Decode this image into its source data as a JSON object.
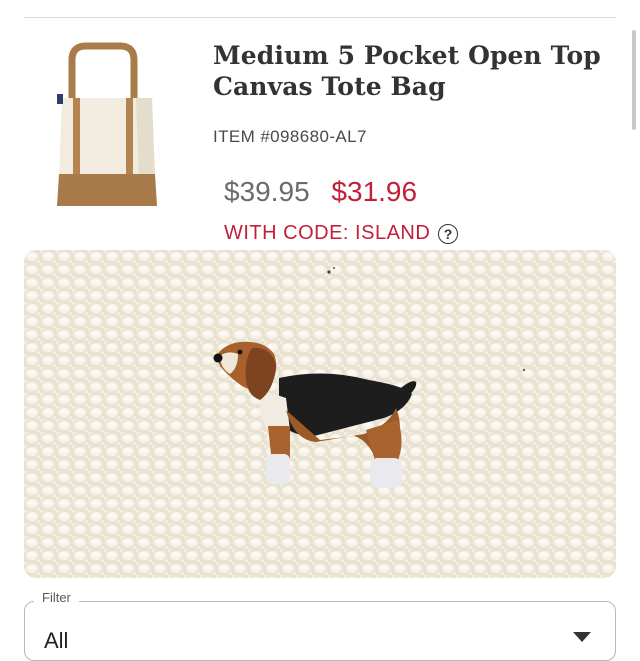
{
  "product": {
    "title_line1": "Medium 5 Pocket Open Top",
    "title_line2": "Canvas Tote Bag",
    "item_number": "ITEM #098680-AL7",
    "price_original": "$39.95",
    "price_sale": "$31.96",
    "promo_text": "WITH CODE: ISLAND",
    "help_icon_glyph": "?"
  },
  "filter": {
    "label": "Filter",
    "value": "All"
  },
  "images": {
    "thumbnail_icon": "tote-bag-icon",
    "swatch_icon": "beagle-embroidery-icon"
  },
  "colors": {
    "sale_red": "#c41e3a",
    "canvas_natural": "#ede6d6",
    "tote_tan": "#b07f4b"
  }
}
